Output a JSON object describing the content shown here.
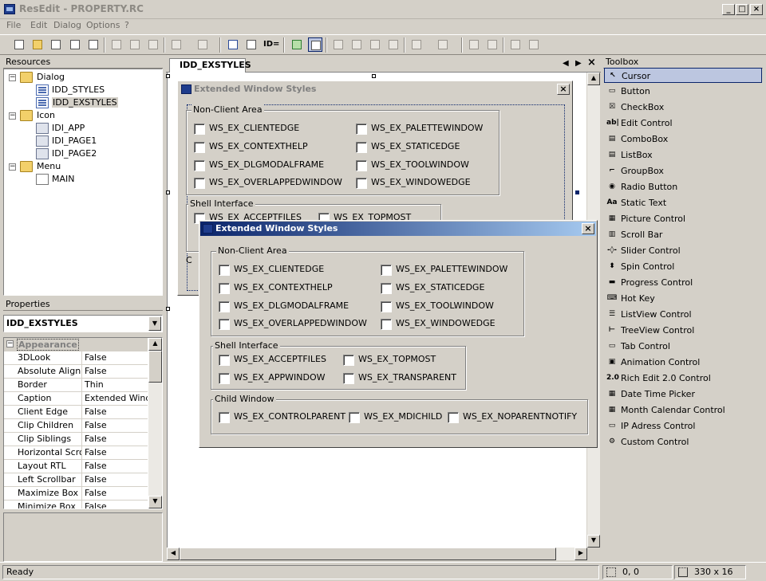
{
  "window": {
    "title": "ResEdit - PROPERTY.RC"
  },
  "menu": [
    "File",
    "Edit",
    "Dialog",
    "Options",
    "?"
  ],
  "toolbar": {
    "id_label": "ID="
  },
  "resources": {
    "header": "Resources",
    "tree": [
      {
        "label": "Dialog",
        "icon": "folder-icon",
        "level": 0
      },
      {
        "label": "IDD_STYLES",
        "icon": "dialog-icon",
        "level": 1
      },
      {
        "label": "IDD_EXSTYLES",
        "icon": "dialog-icon",
        "level": 1,
        "selected": true
      },
      {
        "label": "Icon",
        "icon": "folder-icon",
        "level": 0
      },
      {
        "label": "IDI_APP",
        "icon": "icon-resource-icon",
        "level": 1
      },
      {
        "label": "IDI_PAGE1",
        "icon": "icon-resource-icon",
        "level": 1
      },
      {
        "label": "IDI_PAGE2",
        "icon": "icon-resource-icon",
        "level": 1
      },
      {
        "label": "Menu",
        "icon": "folder-icon",
        "level": 0
      },
      {
        "label": "MAIN",
        "icon": "menu-resource-icon",
        "level": 1
      }
    ]
  },
  "properties": {
    "header": "Properties",
    "selected_object": "IDD_EXSTYLES",
    "category": "Appearance",
    "rows": [
      {
        "name": "3DLook",
        "value": "False"
      },
      {
        "name": "Absolute Align",
        "value": "False"
      },
      {
        "name": "Border",
        "value": "Thin"
      },
      {
        "name": "Caption",
        "value": "Extended Windo"
      },
      {
        "name": "Client Edge",
        "value": "False"
      },
      {
        "name": "Clip Children",
        "value": "False"
      },
      {
        "name": "Clip Siblings",
        "value": "False"
      },
      {
        "name": "Horizontal Scrollb",
        "value": "False"
      },
      {
        "name": "Layout RTL",
        "value": "False"
      },
      {
        "name": "Left Scrollbar",
        "value": "False"
      },
      {
        "name": "Maximize Box",
        "value": "False"
      },
      {
        "name": "Minimize Box",
        "value": "False"
      }
    ]
  },
  "editor": {
    "tab": "IDD_EXSTYLES",
    "back_dialog": {
      "title": "Extended Window Styles",
      "group_nonclient": "Non-Client Area",
      "nonclient_left": [
        "WS_EX_CLIENTEDGE",
        "WS_EX_CONTEXTHELP",
        "WS_EX_DLGMODALFRAME",
        "WS_EX_OVERLAPPEDWINDOW"
      ],
      "nonclient_right": [
        "WS_EX_PALETTEWINDOW",
        "WS_EX_STATICEDGE",
        "WS_EX_TOOLWINDOW",
        "WS_EX_WINDOWEDGE"
      ],
      "group_shell": "Shell Interface",
      "shell_visible": [
        "WS_EX_ACCEPTFILES",
        "WS_EX_TOPMOST"
      ],
      "group_child_partial": "C"
    },
    "preview_dialog": {
      "title": "Extended Window Styles",
      "group_nonclient": "Non-Client Area",
      "nonclient_left": [
        "WS_EX_CLIENTEDGE",
        "WS_EX_CONTEXTHELP",
        "WS_EX_DLGMODALFRAME",
        "WS_EX_OVERLAPPEDWINDOW"
      ],
      "nonclient_right": [
        "WS_EX_PALETTEWINDOW",
        "WS_EX_STATICEDGE",
        "WS_EX_TOOLWINDOW",
        "WS_EX_WINDOWEDGE"
      ],
      "group_shell": "Shell Interface",
      "shell_left": [
        "WS_EX_ACCEPTFILES",
        "WS_EX_APPWINDOW"
      ],
      "shell_right": [
        "WS_EX_TOPMOST",
        "WS_EX_TRANSPARENT"
      ],
      "group_child": "Child Window",
      "child": [
        "WS_EX_CONTROLPARENT",
        "WS_EX_MDICHILD",
        "WS_EX_NOPARENTNOTIFY"
      ]
    }
  },
  "toolbox": {
    "header": "Toolbox",
    "items": [
      {
        "label": "Cursor",
        "glyph": "↖",
        "selected": true
      },
      {
        "label": "Button",
        "glyph": "▭"
      },
      {
        "label": "CheckBox",
        "glyph": "☒"
      },
      {
        "label": "Edit Control",
        "glyph": "ab|"
      },
      {
        "label": "ComboBox",
        "glyph": "▤"
      },
      {
        "label": "ListBox",
        "glyph": "▤"
      },
      {
        "label": "GroupBox",
        "glyph": "⌐"
      },
      {
        "label": "Radio Button",
        "glyph": "◉"
      },
      {
        "label": "Static Text",
        "glyph": "Aa"
      },
      {
        "label": "Picture Control",
        "glyph": "▦"
      },
      {
        "label": "Scroll Bar",
        "glyph": "▥"
      },
      {
        "label": "Slider Control",
        "glyph": "-◊-"
      },
      {
        "label": "Spin Control",
        "glyph": "⬍"
      },
      {
        "label": "Progress Control",
        "glyph": "▬"
      },
      {
        "label": "Hot Key",
        "glyph": "⌨"
      },
      {
        "label": "ListView Control",
        "glyph": "☰"
      },
      {
        "label": "TreeView Control",
        "glyph": "⊢"
      },
      {
        "label": "Tab Control",
        "glyph": "▭"
      },
      {
        "label": "Animation Control",
        "glyph": "▣"
      },
      {
        "label": "Rich Edit 2.0 Control",
        "glyph": "2.0"
      },
      {
        "label": "Date Time Picker",
        "glyph": "▦"
      },
      {
        "label": "Month Calendar Control",
        "glyph": "▦"
      },
      {
        "label": "IP Adress Control",
        "glyph": "▭"
      },
      {
        "label": "Custom Control",
        "glyph": "⚙"
      }
    ]
  },
  "status": {
    "text": "Ready",
    "position": "0, 0",
    "size": "330 x 16"
  }
}
